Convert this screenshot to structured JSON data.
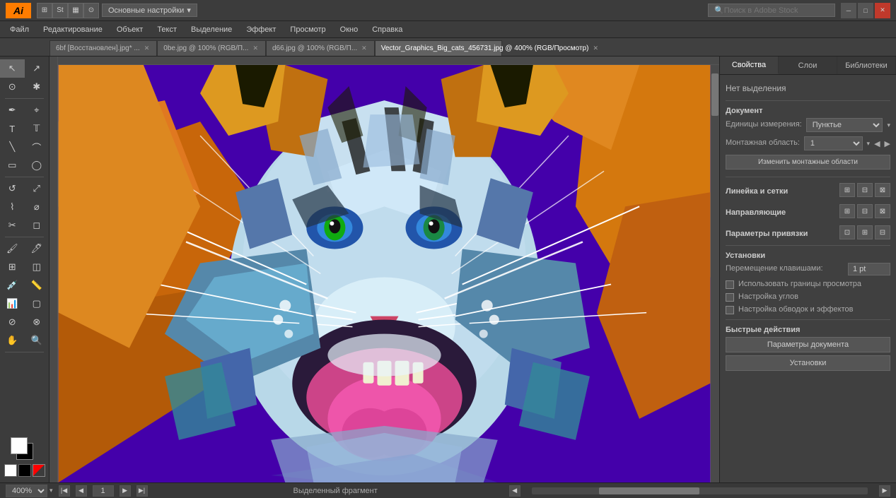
{
  "titlebar": {
    "logo": "Ai",
    "workspace_label": "Основные настройки",
    "search_placeholder": "Поиск в Adobe Stock",
    "win_minimize": "─",
    "win_maximize": "□",
    "win_close": "✕"
  },
  "menubar": {
    "items": [
      "Файл",
      "Редактирование",
      "Объект",
      "Текст",
      "Выделение",
      "Эффект",
      "Просмотр",
      "Окно",
      "Справка"
    ]
  },
  "tabs": [
    {
      "label": "6bf [Восстановлен].jpg* ...",
      "active": false
    },
    {
      "label": "0be.jpg @ 100% (RGB/П...",
      "active": false
    },
    {
      "label": "d66.jpg @ 100% (RGB/П...",
      "active": false
    },
    {
      "label": "Vector_Graphics_Big_cats_456731.jpg @ 400% (RGB/Просмотр)",
      "active": true
    }
  ],
  "panel": {
    "tabs": [
      "Свойства",
      "Слои",
      "Библиотеки"
    ],
    "active_tab": "Свойства",
    "no_selection": "Нет выделения",
    "section_document": "Документ",
    "label_units": "Единицы измерения:",
    "units_value": "Пунктье",
    "label_artboard": "Монтажная область:",
    "artboard_value": "1",
    "btn_change_artboard": "Изменить монтажные области",
    "section_rulers": "Линейка и сетки",
    "section_guides": "Направляющие",
    "section_snap": "Параметры привязки",
    "section_settings": "Установки",
    "label_keyboard_move": "Перемещение клавишами:",
    "keyboard_move_value": "1 pt",
    "cb_view_bounds": "Использовать границы просмотра",
    "cb_corner_widget": "Настройка углов",
    "cb_stroke_effects": "Настройка обводок и эффектов",
    "section_quick": "Быстрые действия",
    "btn_doc_settings": "Параметры документа",
    "btn_preferences": "Установки"
  },
  "statusbar": {
    "zoom": "400%",
    "page": "1",
    "status_text": "Выделенный фрагмент"
  },
  "tools": [
    "↖",
    "⤢",
    "✏",
    "✒",
    "T",
    "\\",
    "⬚",
    "◯",
    "⟲",
    "↔",
    "✂",
    "✱",
    "⊕",
    "📊",
    "/",
    "✋",
    "🔍"
  ]
}
